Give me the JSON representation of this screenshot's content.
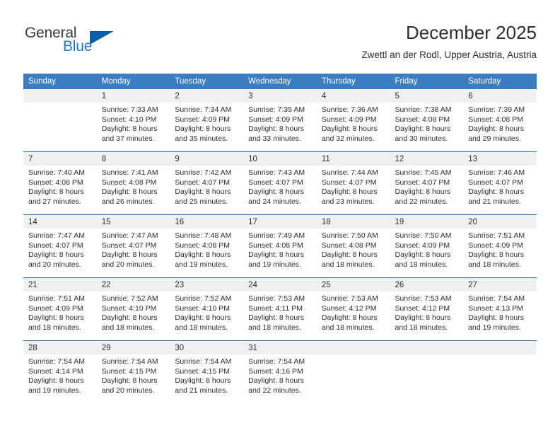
{
  "brand": {
    "name_top": "General",
    "name_bottom": "Blue",
    "triangle_color": "#0d60a8",
    "blue_color": "#2179c0"
  },
  "header": {
    "title": "December 2025",
    "subtitle": "Zwettl an der Rodl, Upper Austria, Austria"
  },
  "theme": {
    "header_bg": "#3b7dc0",
    "row_divider": "#2c6ca8",
    "daynum_band_bg": "#f0f0f0",
    "text": "#2e2e2e"
  },
  "columns": [
    "Sunday",
    "Monday",
    "Tuesday",
    "Wednesday",
    "Thursday",
    "Friday",
    "Saturday"
  ],
  "weeks": [
    [
      {
        "day": "",
        "lines": []
      },
      {
        "day": "1",
        "lines": [
          "Sunrise: 7:33 AM",
          "Sunset: 4:10 PM",
          "Daylight: 8 hours",
          "and 37 minutes."
        ]
      },
      {
        "day": "2",
        "lines": [
          "Sunrise: 7:34 AM",
          "Sunset: 4:09 PM",
          "Daylight: 8 hours",
          "and 35 minutes."
        ]
      },
      {
        "day": "3",
        "lines": [
          "Sunrise: 7:35 AM",
          "Sunset: 4:09 PM",
          "Daylight: 8 hours",
          "and 33 minutes."
        ]
      },
      {
        "day": "4",
        "lines": [
          "Sunrise: 7:36 AM",
          "Sunset: 4:09 PM",
          "Daylight: 8 hours",
          "and 32 minutes."
        ]
      },
      {
        "day": "5",
        "lines": [
          "Sunrise: 7:38 AM",
          "Sunset: 4:08 PM",
          "Daylight: 8 hours",
          "and 30 minutes."
        ]
      },
      {
        "day": "6",
        "lines": [
          "Sunrise: 7:39 AM",
          "Sunset: 4:08 PM",
          "Daylight: 8 hours",
          "and 29 minutes."
        ]
      }
    ],
    [
      {
        "day": "7",
        "lines": [
          "Sunrise: 7:40 AM",
          "Sunset: 4:08 PM",
          "Daylight: 8 hours",
          "and 27 minutes."
        ]
      },
      {
        "day": "8",
        "lines": [
          "Sunrise: 7:41 AM",
          "Sunset: 4:08 PM",
          "Daylight: 8 hours",
          "and 26 minutes."
        ]
      },
      {
        "day": "9",
        "lines": [
          "Sunrise: 7:42 AM",
          "Sunset: 4:07 PM",
          "Daylight: 8 hours",
          "and 25 minutes."
        ]
      },
      {
        "day": "10",
        "lines": [
          "Sunrise: 7:43 AM",
          "Sunset: 4:07 PM",
          "Daylight: 8 hours",
          "and 24 minutes."
        ]
      },
      {
        "day": "11",
        "lines": [
          "Sunrise: 7:44 AM",
          "Sunset: 4:07 PM",
          "Daylight: 8 hours",
          "and 23 minutes."
        ]
      },
      {
        "day": "12",
        "lines": [
          "Sunrise: 7:45 AM",
          "Sunset: 4:07 PM",
          "Daylight: 8 hours",
          "and 22 minutes."
        ]
      },
      {
        "day": "13",
        "lines": [
          "Sunrise: 7:46 AM",
          "Sunset: 4:07 PM",
          "Daylight: 8 hours",
          "and 21 minutes."
        ]
      }
    ],
    [
      {
        "day": "14",
        "lines": [
          "Sunrise: 7:47 AM",
          "Sunset: 4:07 PM",
          "Daylight: 8 hours",
          "and 20 minutes."
        ]
      },
      {
        "day": "15",
        "lines": [
          "Sunrise: 7:47 AM",
          "Sunset: 4:07 PM",
          "Daylight: 8 hours",
          "and 20 minutes."
        ]
      },
      {
        "day": "16",
        "lines": [
          "Sunrise: 7:48 AM",
          "Sunset: 4:08 PM",
          "Daylight: 8 hours",
          "and 19 minutes."
        ]
      },
      {
        "day": "17",
        "lines": [
          "Sunrise: 7:49 AM",
          "Sunset: 4:08 PM",
          "Daylight: 8 hours",
          "and 19 minutes."
        ]
      },
      {
        "day": "18",
        "lines": [
          "Sunrise: 7:50 AM",
          "Sunset: 4:08 PM",
          "Daylight: 8 hours",
          "and 18 minutes."
        ]
      },
      {
        "day": "19",
        "lines": [
          "Sunrise: 7:50 AM",
          "Sunset: 4:09 PM",
          "Daylight: 8 hours",
          "and 18 minutes."
        ]
      },
      {
        "day": "20",
        "lines": [
          "Sunrise: 7:51 AM",
          "Sunset: 4:09 PM",
          "Daylight: 8 hours",
          "and 18 minutes."
        ]
      }
    ],
    [
      {
        "day": "21",
        "lines": [
          "Sunrise: 7:51 AM",
          "Sunset: 4:09 PM",
          "Daylight: 8 hours",
          "and 18 minutes."
        ]
      },
      {
        "day": "22",
        "lines": [
          "Sunrise: 7:52 AM",
          "Sunset: 4:10 PM",
          "Daylight: 8 hours",
          "and 18 minutes."
        ]
      },
      {
        "day": "23",
        "lines": [
          "Sunrise: 7:52 AM",
          "Sunset: 4:10 PM",
          "Daylight: 8 hours",
          "and 18 minutes."
        ]
      },
      {
        "day": "24",
        "lines": [
          "Sunrise: 7:53 AM",
          "Sunset: 4:11 PM",
          "Daylight: 8 hours",
          "and 18 minutes."
        ]
      },
      {
        "day": "25",
        "lines": [
          "Sunrise: 7:53 AM",
          "Sunset: 4:12 PM",
          "Daylight: 8 hours",
          "and 18 minutes."
        ]
      },
      {
        "day": "26",
        "lines": [
          "Sunrise: 7:53 AM",
          "Sunset: 4:12 PM",
          "Daylight: 8 hours",
          "and 18 minutes."
        ]
      },
      {
        "day": "27",
        "lines": [
          "Sunrise: 7:54 AM",
          "Sunset: 4:13 PM",
          "Daylight: 8 hours",
          "and 19 minutes."
        ]
      }
    ],
    [
      {
        "day": "28",
        "lines": [
          "Sunrise: 7:54 AM",
          "Sunset: 4:14 PM",
          "Daylight: 8 hours",
          "and 19 minutes."
        ]
      },
      {
        "day": "29",
        "lines": [
          "Sunrise: 7:54 AM",
          "Sunset: 4:15 PM",
          "Daylight: 8 hours",
          "and 20 minutes."
        ]
      },
      {
        "day": "30",
        "lines": [
          "Sunrise: 7:54 AM",
          "Sunset: 4:15 PM",
          "Daylight: 8 hours",
          "and 21 minutes."
        ]
      },
      {
        "day": "31",
        "lines": [
          "Sunrise: 7:54 AM",
          "Sunset: 4:16 PM",
          "Daylight: 8 hours",
          "and 22 minutes."
        ]
      },
      {
        "day": "",
        "lines": []
      },
      {
        "day": "",
        "lines": []
      },
      {
        "day": "",
        "lines": []
      }
    ]
  ]
}
